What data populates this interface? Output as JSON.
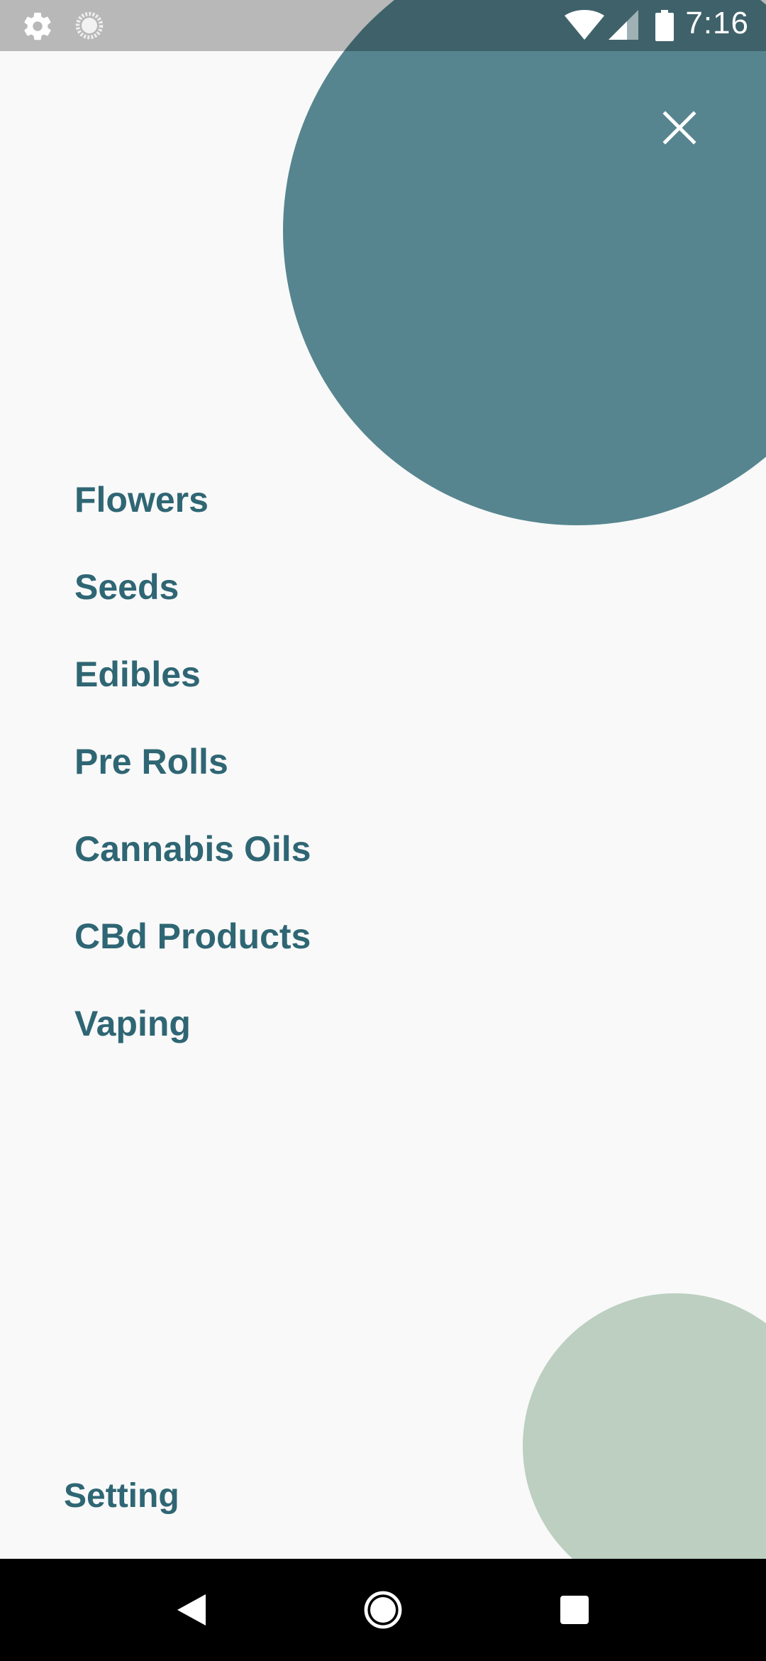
{
  "status_bar": {
    "time": "7:16",
    "left_icons": [
      "settings-gear-icon",
      "loading-spinner-icon"
    ],
    "right_icons": [
      "wifi-icon",
      "cell-signal-icon",
      "battery-icon"
    ]
  },
  "drawer": {
    "close_icon": "close-icon",
    "menu_items": [
      {
        "label": "Flowers"
      },
      {
        "label": "Seeds"
      },
      {
        "label": "Edibles"
      },
      {
        "label": "Pre Rolls"
      },
      {
        "label": "Cannabis Oils"
      },
      {
        "label": "CBd Products"
      },
      {
        "label": "Vaping"
      }
    ],
    "setting_label": "Setting"
  },
  "nav_bar": {
    "buttons": [
      "back-icon",
      "home-icon",
      "recents-icon"
    ]
  },
  "colors": {
    "accent_text": "#2f6674",
    "top_circle": "#56858f",
    "bottom_circle": "#bccfc1",
    "background": "#f9f9f9"
  }
}
